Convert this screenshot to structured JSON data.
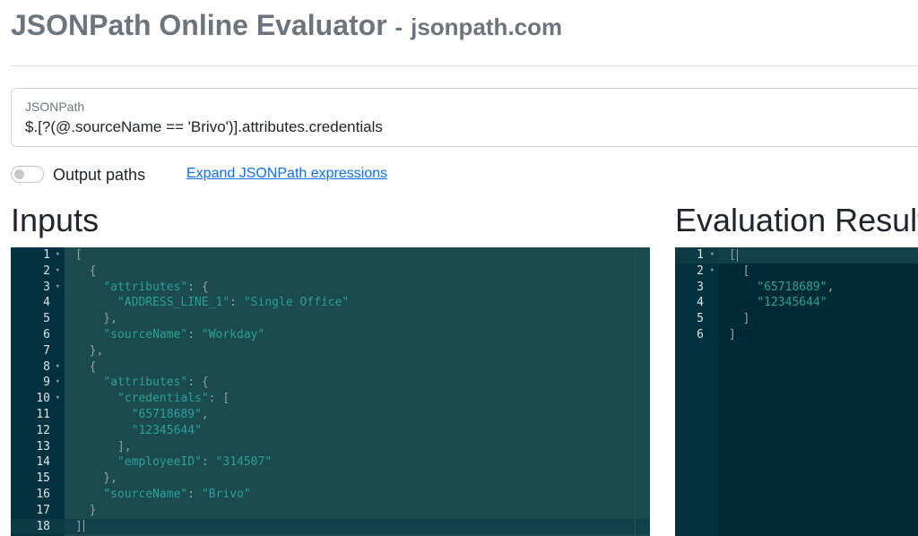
{
  "header": {
    "title": "JSONPath Online Evaluator",
    "separator": "-",
    "site": "jsonpath.com"
  },
  "query": {
    "label": "JSONPath",
    "value": "$.[?(@.sourceName == 'Brivo')].attributes.credentials"
  },
  "options": {
    "output_paths_label": "Output paths",
    "output_paths_on": false,
    "expand_link": "Expand JSONPath expressions"
  },
  "inputs": {
    "heading": "Inputs",
    "lines": [
      "[",
      "  {",
      "    \"attributes\": {",
      "      \"ADDRESS_LINE_1\": \"Single Office\"",
      "    },",
      "    \"sourceName\": \"Workday\"",
      "  },",
      "  {",
      "    \"attributes\": {",
      "      \"credentials\": [",
      "        \"65718689\",",
      "        \"12345644\"",
      "      ],",
      "      \"employeeID\": \"314507\"",
      "    },",
      "    \"sourceName\": \"Brivo\"",
      "  }",
      "]"
    ],
    "fold_lines": [
      1,
      2,
      3,
      8,
      9,
      10
    ]
  },
  "results": {
    "heading": "Evaluation Results",
    "lines": [
      "[",
      "  [",
      "    \"65718689\",",
      "    \"12345644\"",
      "  ]",
      "]"
    ],
    "fold_lines": [
      1,
      2
    ]
  },
  "colors": {
    "editor_bg": "#002b36",
    "string": "#2aa198",
    "text": "#93a1a1",
    "link": "#0d6efd"
  }
}
